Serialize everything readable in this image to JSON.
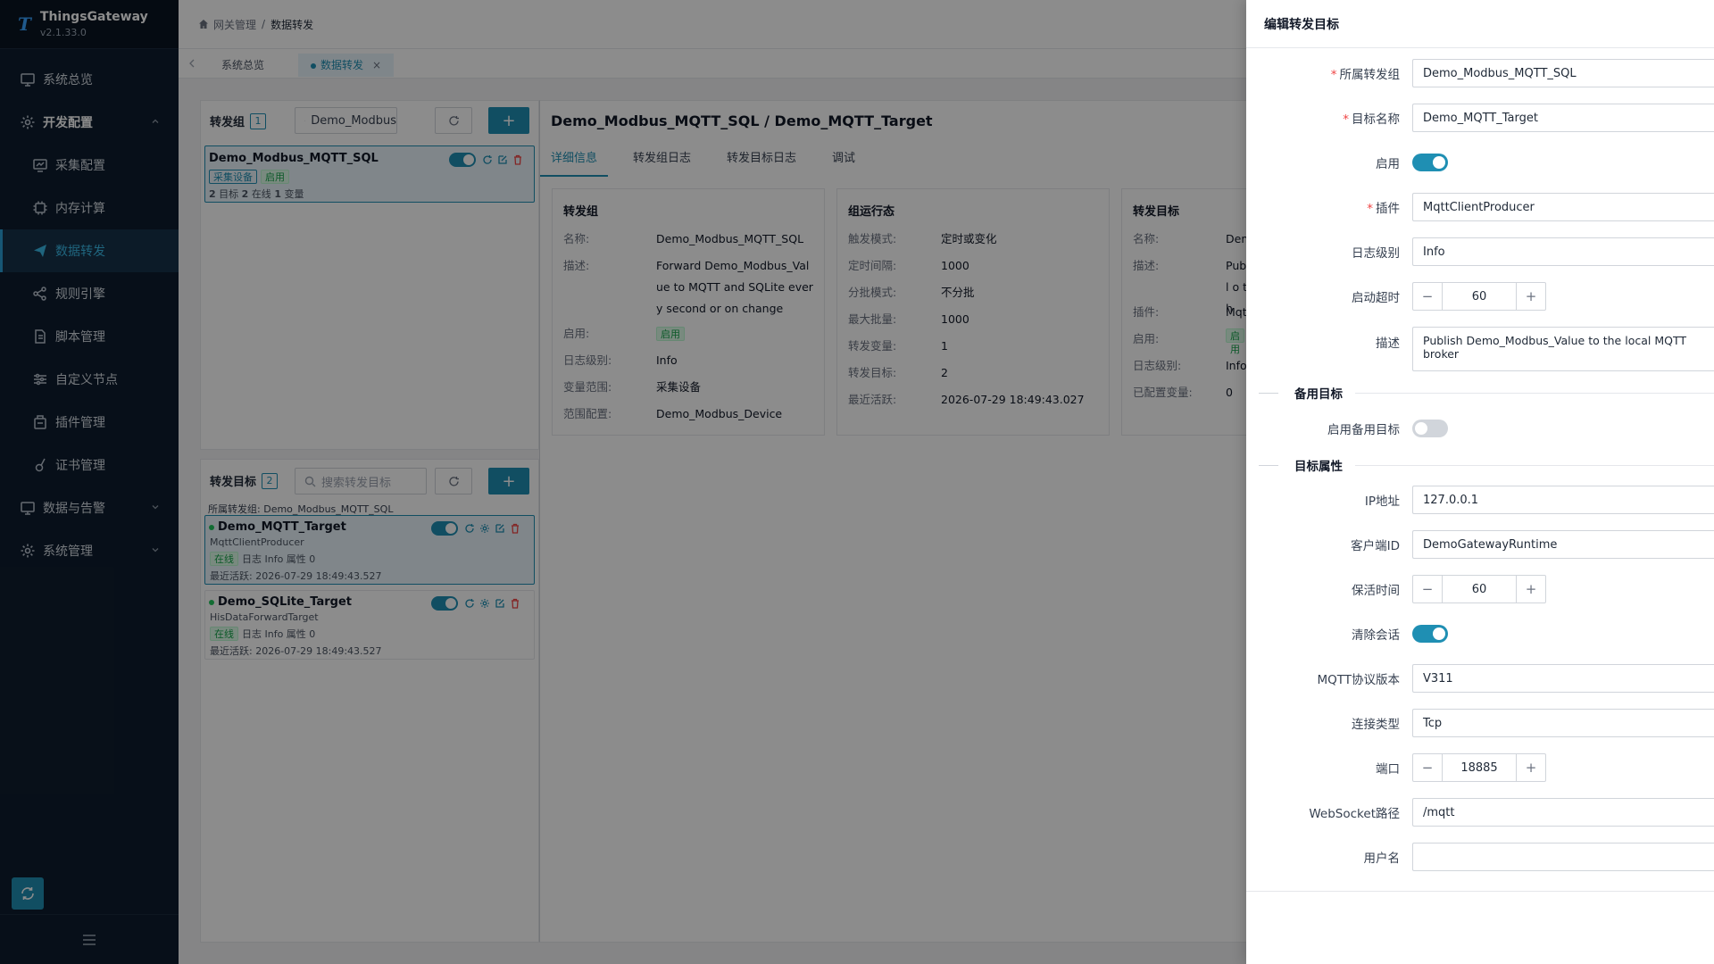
{
  "app": {
    "name": "ThingsGateway",
    "version": "v2.1.33.0"
  },
  "sidebar": {
    "items": [
      {
        "label": "系统总览",
        "icon": "monitor-icon"
      },
      {
        "label": "开发配置",
        "icon": "gear-icon"
      },
      {
        "label": "采集配置",
        "icon": "chart-monitor-icon"
      },
      {
        "label": "内存计算",
        "icon": "chip-icon"
      },
      {
        "label": "数据转发",
        "icon": "send-icon"
      },
      {
        "label": "规则引擎",
        "icon": "share-icon"
      },
      {
        "label": "脚本管理",
        "icon": "document-icon"
      },
      {
        "label": "自定义节点",
        "icon": "sliders-icon"
      },
      {
        "label": "插件管理",
        "icon": "plugin-icon"
      },
      {
        "label": "证书管理",
        "icon": "certificate-icon"
      },
      {
        "label": "数据与告警",
        "icon": "monitor-icon"
      },
      {
        "label": "系统管理",
        "icon": "gear-icon"
      }
    ]
  },
  "breadcrumb": {
    "root": "网关管理",
    "sep": "/",
    "current": "数据转发"
  },
  "tabs": [
    {
      "label": "系统总览"
    },
    {
      "label": "数据转发"
    }
  ],
  "groups": {
    "title": "转发组",
    "count": "1",
    "search_value": "Demo_Modbus",
    "items": [
      {
        "name": "Demo_Modbus_MQTT_SQL",
        "badge1": "采集设备",
        "badge2": "启用",
        "stats": {
          "n1": "2",
          "l1": "目标",
          "n2": "2",
          "l2": "在线",
          "n3": "1",
          "l3": "变量"
        }
      }
    ]
  },
  "targets": {
    "title": "转发目标",
    "count": "2",
    "search_placeholder": "搜索转发目标",
    "group_label": "所属转发组:",
    "group_name": "Demo_Modbus_MQTT_SQL",
    "items": [
      {
        "name": "Demo_MQTT_Target",
        "plugin": "MqttClientProducer",
        "status": "在线",
        "meta": "日志 Info 属性 0",
        "last_active": "最近活跃:  2026-07-29 18:49:43.527"
      },
      {
        "name": "Demo_SQLite_Target",
        "plugin": "HisDataForwardTarget",
        "status": "在线",
        "meta": "日志 Info 属性 0",
        "last_active": "最近活跃:  2026-07-29 18:49:43.527"
      }
    ]
  },
  "detail": {
    "title": "Demo_Modbus_MQTT_SQL / Demo_MQTT_Target",
    "tabs": [
      "详细信息",
      "转发组日志",
      "转发目标日志",
      "调试"
    ],
    "group_card": {
      "title": "转发组",
      "rows": [
        {
          "k": "名称:",
          "v": "Demo_Modbus_MQTT_SQL"
        },
        {
          "k": "描述:",
          "v": "Forward Demo_Modbus_Value to MQTT and SQLite every second or on change"
        },
        {
          "k": "启用:",
          "v": "启用"
        },
        {
          "k": "日志级别:",
          "v": "Info"
        },
        {
          "k": "变量范围:",
          "v": "采集设备"
        },
        {
          "k": "范围配置:",
          "v": "Demo_Modbus_Device"
        }
      ]
    },
    "runtime_card": {
      "title": "组运行态",
      "rows": [
        {
          "k": "触发模式:",
          "v": "定时或变化"
        },
        {
          "k": "定时间隔:",
          "v": "1000"
        },
        {
          "k": "分批模式:",
          "v": "不分批"
        },
        {
          "k": "最大批量:",
          "v": "1000"
        },
        {
          "k": "转发变量:",
          "v": "1"
        },
        {
          "k": "转发目标:",
          "v": "2"
        },
        {
          "k": "最近活跃:",
          "v": "2026-07-29 18:49:43.027"
        }
      ]
    },
    "target_card": {
      "title": "转发目标",
      "rows": [
        {
          "k": "名称:",
          "v": "Dem"
        },
        {
          "k": "描述:",
          "v": "Publ o th"
        },
        {
          "k": "插件:",
          "v": "Mqt"
        },
        {
          "k": "启用:",
          "v": "启用"
        },
        {
          "k": "日志级别:",
          "v": "Info"
        },
        {
          "k": "已配置变量:",
          "v": "0"
        }
      ]
    }
  },
  "drawer": {
    "title": "编辑转发目标",
    "fields": {
      "group": {
        "label": "所属转发组",
        "value": "Demo_Modbus_MQTT_SQL"
      },
      "name": {
        "label": "目标名称",
        "value": "Demo_MQTT_Target"
      },
      "enable": {
        "label": "启用",
        "on": true
      },
      "plugin": {
        "label": "插件",
        "value": "MqttClientProducer"
      },
      "log_level": {
        "label": "日志级别",
        "value": "Info"
      },
      "start_timeout": {
        "label": "启动超时",
        "value": "60"
      },
      "desc": {
        "label": "描述",
        "value": "Publish Demo_Modbus_Value to the local MQTT broker"
      }
    },
    "backup_section": "备用目标",
    "backup_enable": {
      "label": "启用备用目标",
      "on": false
    },
    "props_section": "目标属性",
    "props": {
      "ip": {
        "label": "IP地址",
        "value": "127.0.0.1"
      },
      "client_id": {
        "label": "客户端ID",
        "value": "DemoGatewayRuntime"
      },
      "keepalive": {
        "label": "保活时间",
        "value": "60"
      },
      "clean_session": {
        "label": "清除会话",
        "on": true
      },
      "mqtt_version": {
        "label": "MQTT协议版本",
        "value": "V311"
      },
      "conn_type": {
        "label": "连接类型",
        "value": "Tcp"
      },
      "port": {
        "label": "端口",
        "value": "18885"
      },
      "ws_path": {
        "label": "WebSocket路径",
        "value": "/mqtt"
      },
      "username": {
        "label": "用户名",
        "value": ""
      }
    },
    "stepper_minus": "−",
    "stepper_plus": "+"
  },
  "colors": {
    "accent": "#1f8fb3",
    "sidebar_bg": "#0e1d2e",
    "success": "#22c55e",
    "danger": "#ef4444"
  }
}
